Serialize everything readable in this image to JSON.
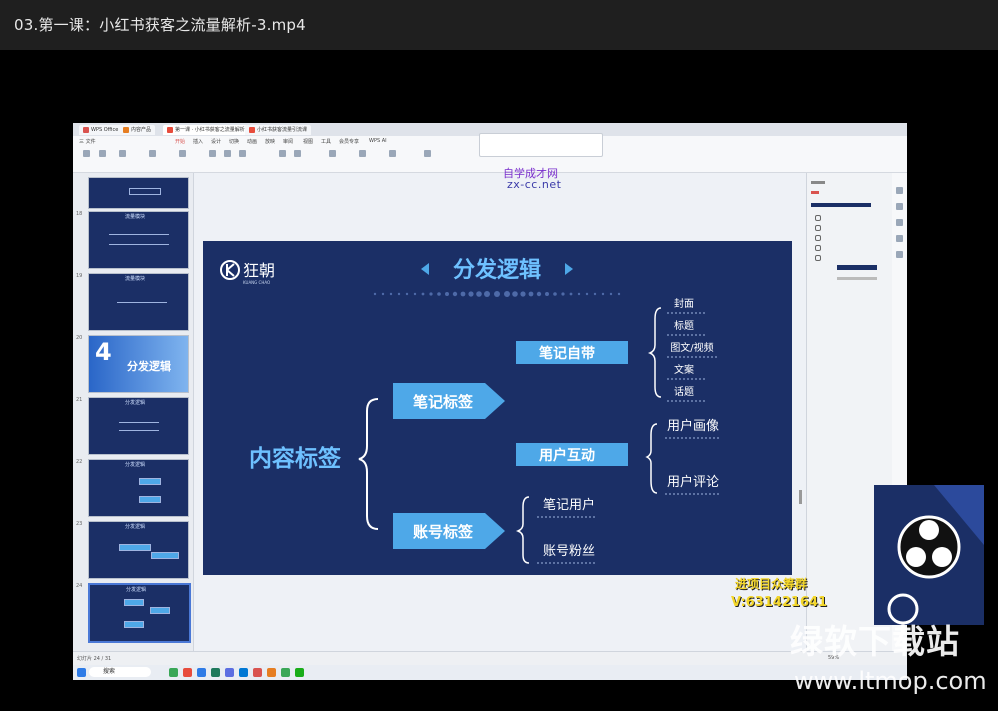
{
  "window": {
    "title": "03.第一课：小红书获客之流量解析-3.mp4"
  },
  "wps": {
    "tabs": [
      "WPS Office",
      "内容产品",
      "第一课 · 小红书获客之流量解析",
      "小红书获客流量引流课"
    ],
    "menu": [
      "三 文件",
      "开始",
      "插入",
      "设计",
      "切换",
      "动画",
      "放映",
      "审阅",
      "视图",
      "工具",
      "会员专享",
      "WPS AI"
    ],
    "active_menu": "开始"
  },
  "watermark": {
    "line1": "自学成才网",
    "line2": "zx-cc.net"
  },
  "thumbnails": [
    {
      "num": "",
      "title": "分发逻辑"
    },
    {
      "num": "18",
      "title": "流量模块"
    },
    {
      "num": "19",
      "title": "流量模块"
    },
    {
      "num": "20",
      "title": "分发逻辑",
      "big": "4"
    },
    {
      "num": "21",
      "title": "分发逻辑"
    },
    {
      "num": "22",
      "title": "分发逻辑"
    },
    {
      "num": "23",
      "title": "分发逻辑"
    },
    {
      "num": "24",
      "title": "分发逻辑"
    }
  ],
  "slide": {
    "logo": "狂朝",
    "logo_sub": "KUANG CHAO",
    "title": "分发逻辑",
    "root": "内容标签",
    "branch1": "笔记标签",
    "branch2": "账号标签",
    "sub1": "笔记自带",
    "sub2": "用户互动",
    "sub3": "笔记用户",
    "sub4": "账号粉丝",
    "leaves1": [
      "封面",
      "标题",
      "图文/视频",
      "文案",
      "话题"
    ],
    "leaves2": [
      "用户画像",
      "用户评论"
    ]
  },
  "status": {
    "slide_info": "幻灯片 24 / 31",
    "zoom": "59%"
  },
  "taskbar": {
    "search_placeholder": "搜索"
  },
  "overlay": {
    "group_text": "进项目众筹群",
    "wechat": "V:631421641",
    "site_name": "绿软下载站",
    "site_url": "www.ltmop.com"
  },
  "colors": {
    "slide_bg": "#1b2f66",
    "accent": "#4ea8e8",
    "highlight": "#f4d72a"
  }
}
